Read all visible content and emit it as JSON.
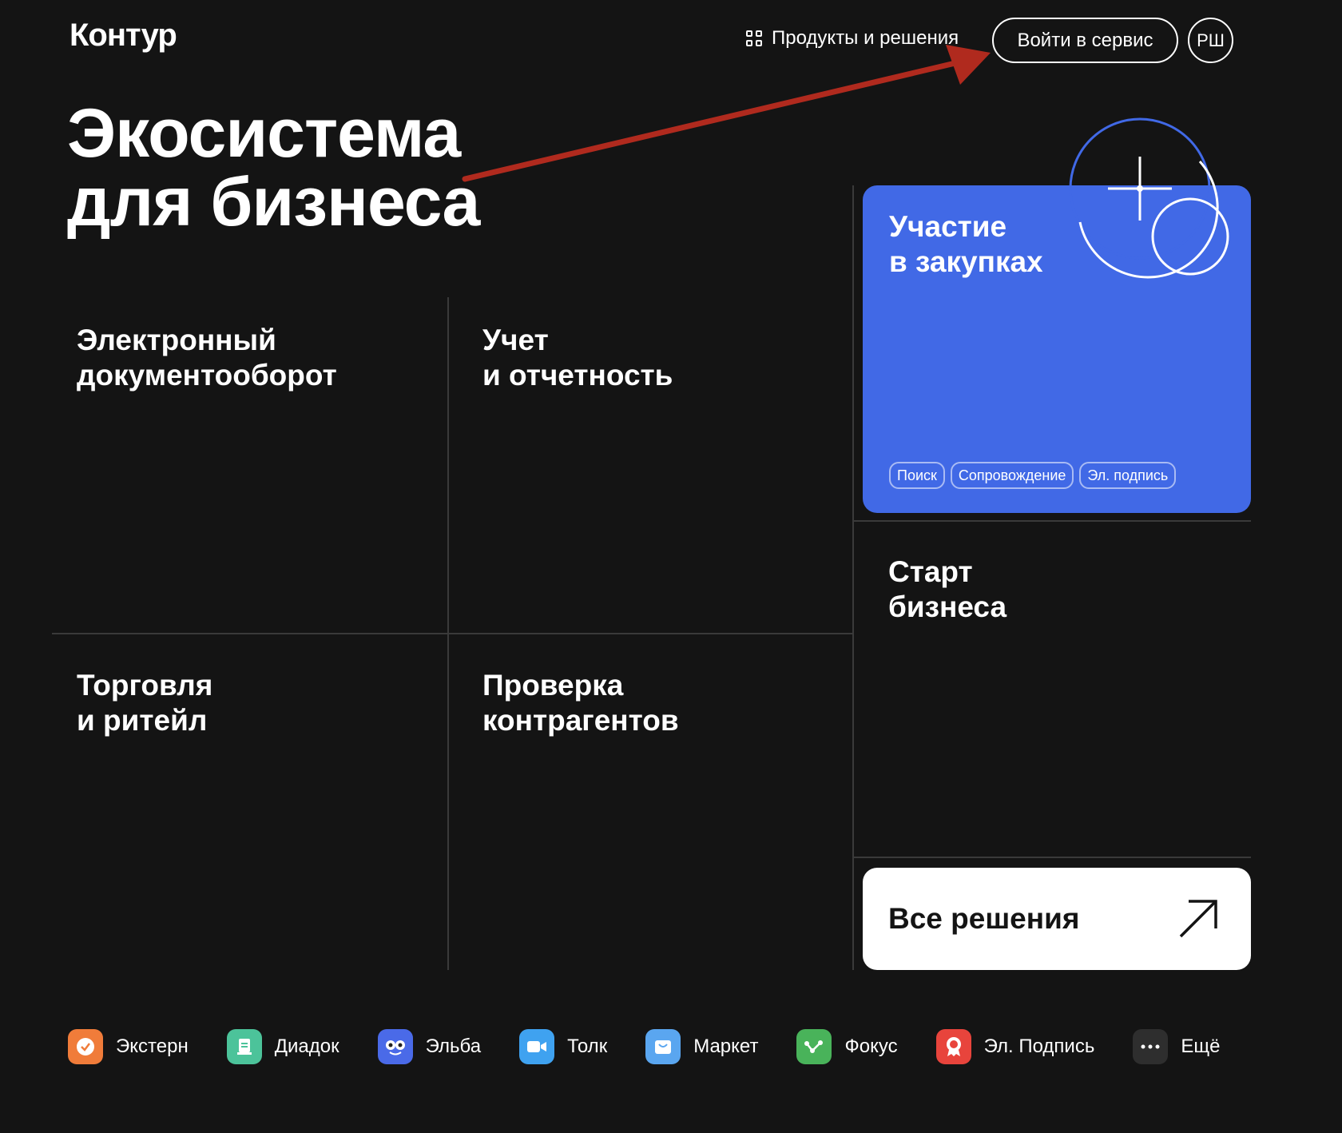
{
  "header": {
    "logo": "Контур",
    "products_label": "Продукты и решения",
    "login_label": "Войти в сервис",
    "avatar_initials": "РШ"
  },
  "hero": {
    "line1": "Экосистема",
    "line2": "для бизнеса"
  },
  "categories": {
    "edo": {
      "line1": "Электронный",
      "line2": "документооборот"
    },
    "accounting": {
      "line1": "Учет",
      "line2": "и отчетность"
    },
    "trade": {
      "line1": "Торговля",
      "line2": "и ритейл"
    },
    "check": {
      "line1": "Проверка",
      "line2": "контрагентов"
    },
    "start": {
      "line1": "Старт",
      "line2": "бизнеса"
    }
  },
  "featured": {
    "line1": "Участие",
    "line2": "в закупках",
    "tags": [
      "Поиск",
      "Сопровождение",
      "Эл. подпись"
    ],
    "color": "#4169e6"
  },
  "all_solutions": {
    "label": "Все решения"
  },
  "products": [
    {
      "name": "Экстерн",
      "icon": "check-icon",
      "color": "#f07c3a"
    },
    {
      "name": "Диадок",
      "icon": "document-icon",
      "color": "#4cc39a"
    },
    {
      "name": "Эльба",
      "icon": "owl-icon",
      "color": "#4a6ae8"
    },
    {
      "name": "Толк",
      "icon": "camera-icon",
      "color": "#3fa2f0"
    },
    {
      "name": "Маркет",
      "icon": "bag-icon",
      "color": "#5aa6f0"
    },
    {
      "name": "Фокус",
      "icon": "graph-icon",
      "color": "#49b35a"
    },
    {
      "name": "Эл. Подпись",
      "icon": "seal-icon",
      "color": "#e8443c"
    },
    {
      "name": "Ещё",
      "icon": "more-icon",
      "color": "#2e2e2e"
    }
  ],
  "colors": {
    "background": "#141414",
    "annotation": "#b02a1e"
  }
}
